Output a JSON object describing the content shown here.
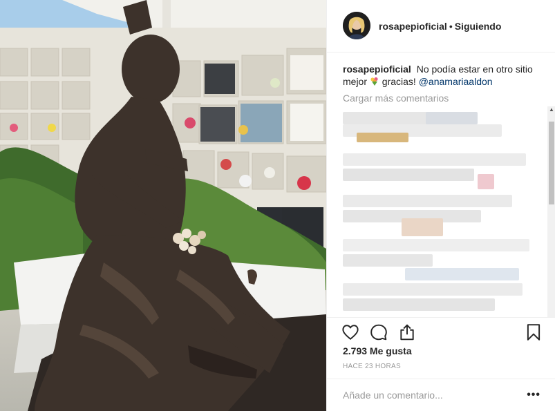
{
  "header": {
    "username": "rosapepioficial",
    "separator": "•",
    "follow_status": "Siguiendo"
  },
  "caption": {
    "username": "rosapepioficial",
    "text_before_emoji": "No podía estar en otro sitio mejor",
    "text_after_emoji": "gracias!",
    "mention": "@anamariaaldon",
    "emoji": "bouquet-emoji"
  },
  "comments": {
    "load_more_label": "Cargar más comentarios"
  },
  "actions": {
    "like_icon": "heart-icon",
    "comment_icon": "comment-icon",
    "share_icon": "share-icon",
    "save_icon": "bookmark-icon"
  },
  "stats": {
    "likes": "2.793 Me gusta",
    "time": "HACE 23 HORAS"
  },
  "add_comment": {
    "placeholder": "Añade un comentario...",
    "more_label": "•••"
  },
  "colors": {
    "text": "#262626",
    "muted": "#999999",
    "mention": "#003569",
    "border": "#efefef"
  }
}
